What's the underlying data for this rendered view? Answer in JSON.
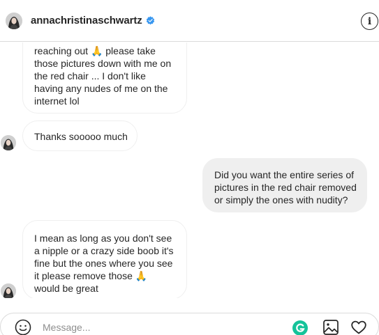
{
  "header": {
    "username": "annachristinaschwartz",
    "verified_color": "#3897f0",
    "info_icon": "info-circle-icon"
  },
  "messages": [
    {
      "sender": "them",
      "lines": [
        "reaching out 🙏 please take",
        "those pictures down with me on",
        "the red chair ... I don't like",
        "having any nudes of me on the",
        "internet lol"
      ]
    },
    {
      "sender": "them",
      "lines": [
        "Thanks sooooo much"
      ]
    },
    {
      "sender": "me",
      "lines": [
        "Did you want the entire series of",
        "pictures in the red chair removed",
        "or simply the ones with nudity?"
      ]
    },
    {
      "sender": "them",
      "lines": [
        "I mean as long as you don't see",
        "a nipple or a crazy side boob it's",
        "fine but the ones where you see",
        "it please remove those 🙏",
        "would be great"
      ]
    }
  ],
  "composer": {
    "placeholder": "Message...",
    "emoji_icon": "smiley-icon",
    "grammarly_icon": "grammarly-icon",
    "grammarly_color": "#15c39a",
    "image_icon": "image-icon",
    "heart_icon": "heart-icon"
  }
}
